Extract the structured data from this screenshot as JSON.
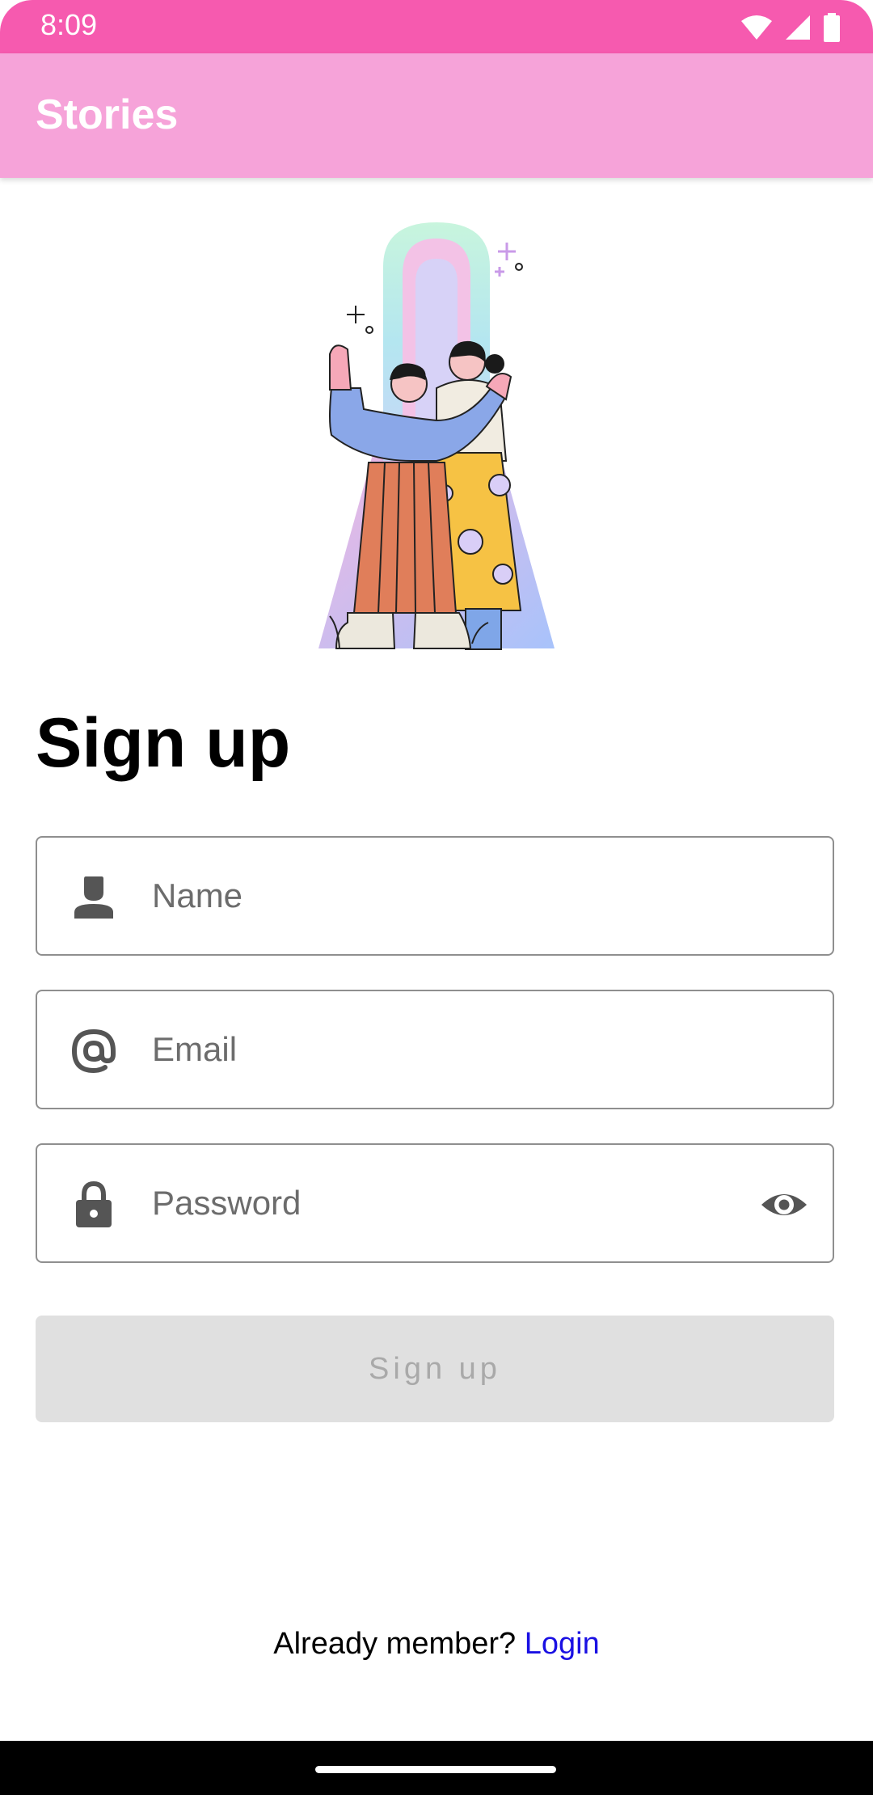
{
  "status_bar": {
    "time": "8:09"
  },
  "app_bar": {
    "title": "Stories"
  },
  "form": {
    "title": "Sign up",
    "name_placeholder": "Name",
    "email_placeholder": "Email",
    "password_placeholder": "Password",
    "submit_label": "Sign up"
  },
  "footer": {
    "prompt": "Already member?",
    "login_label": "Login"
  },
  "icons": {
    "name": "person-icon",
    "email": "at-sign-icon",
    "password": "lock-icon",
    "visibility": "eye-icon"
  },
  "colors": {
    "status_bar": "#f65aaf",
    "app_bar": "#f6a3d9",
    "link": "#1a10e3",
    "button_disabled": "#e0e0e0"
  }
}
